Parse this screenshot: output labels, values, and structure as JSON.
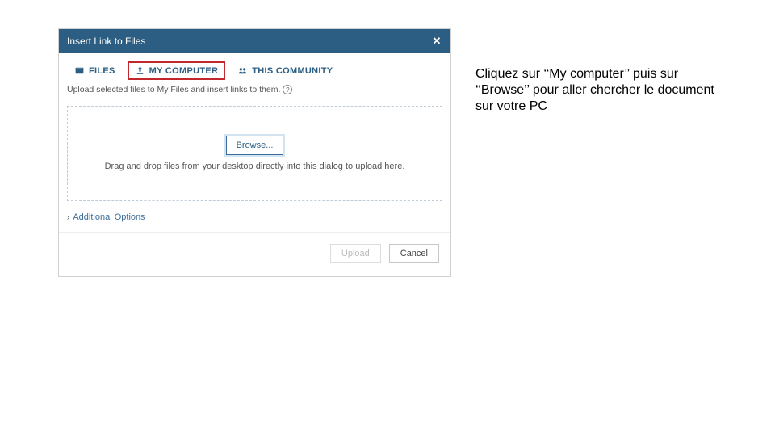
{
  "annotation": "Cliquez sur ‘‘My computer’’ puis sur ‘‘Browse’’ pour aller chercher le document sur votre PC",
  "dialog": {
    "title": "Insert Link to Files",
    "tabs": {
      "files": "FILES",
      "my_computer": "MY COMPUTER",
      "this_community": "THIS COMMUNITY"
    },
    "instruction": "Upload selected files to My Files and insert links to them.",
    "help_symbol": "?",
    "dropzone": {
      "browse_label": "Browse...",
      "hint": "Drag and drop files from your desktop directly into this dialog to upload here."
    },
    "additional_options": "Additional Options",
    "footer": {
      "upload": "Upload",
      "cancel": "Cancel"
    }
  }
}
